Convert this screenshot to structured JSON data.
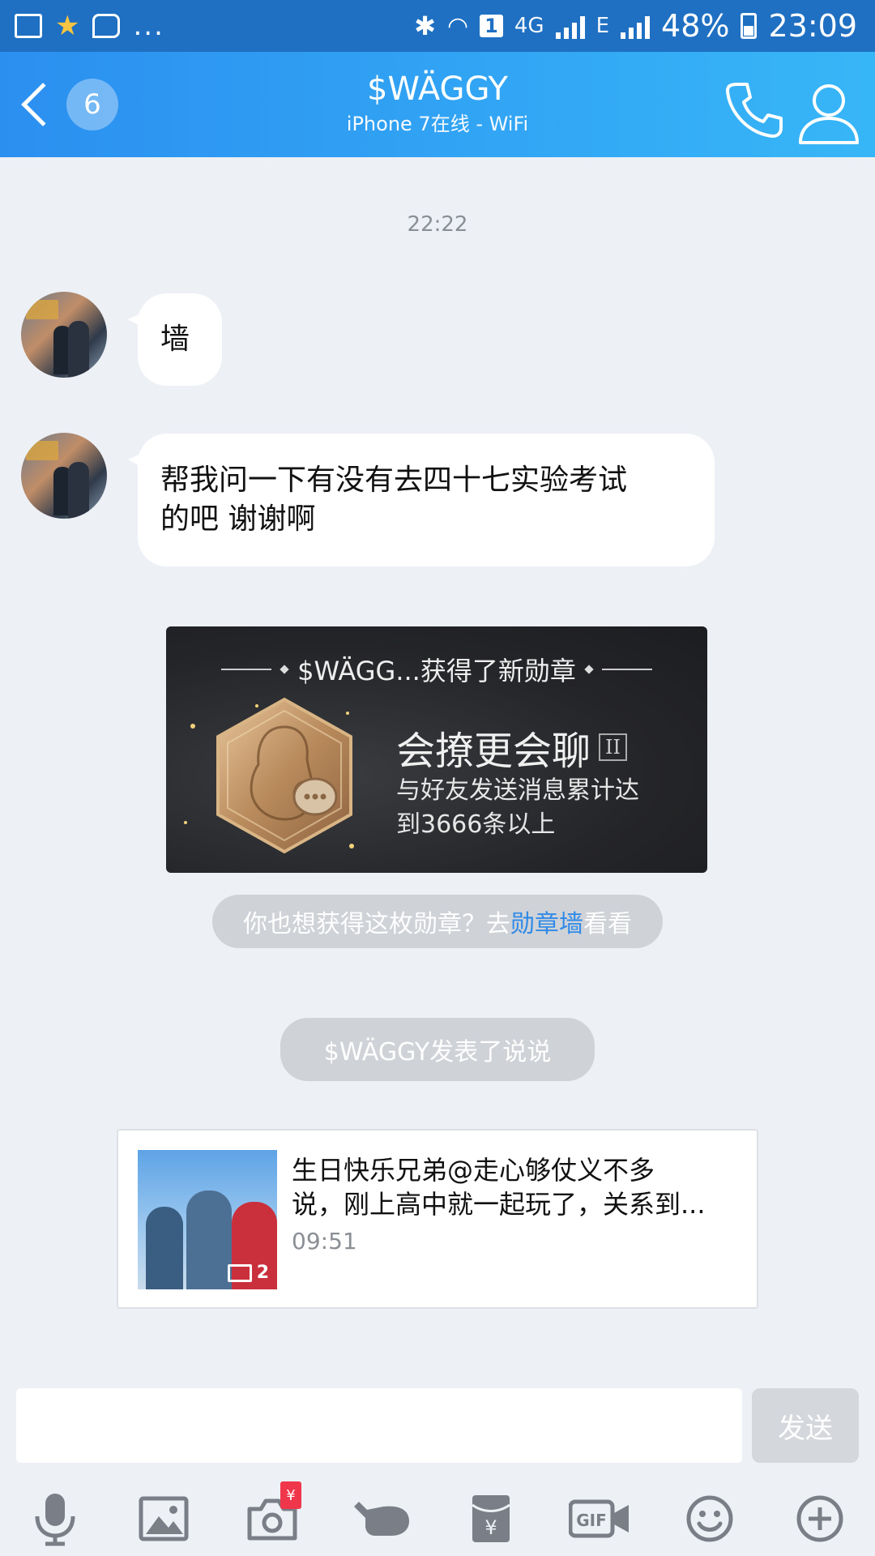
{
  "status_bar": {
    "time": "23:09",
    "battery": "48%",
    "network_4g": "4G",
    "network_e": "E",
    "sim_slot": "1",
    "more": "..."
  },
  "header": {
    "back_badge": "6",
    "contact_name": "$WÄGGY",
    "contact_status": "iPhone 7在线 - WiFi",
    "call_icon": "phone-icon",
    "profile_icon": "person-icon"
  },
  "chat": {
    "timestamp": "22:22",
    "messages": [
      {
        "text": "墙"
      },
      {
        "text_line1": "帮我问一下有没有去四十七实验考试",
        "text_line2": "的吧 谢谢啊"
      }
    ],
    "badge_card": {
      "header": "$WÄGG...获得了新勋章",
      "title": "会撩更会聊",
      "level": "II",
      "desc_line1": "与好友发送消息累计达",
      "desc_line2": "到3666条以上"
    },
    "badge_prompt": {
      "prefix": "你也想获得这枚勋章？去",
      "link": "勋章墙",
      "suffix": "看看"
    },
    "post_notice": "$WÄGGY发表了说说",
    "post": {
      "line1": "生日快乐兄弟@走心够仗义不多",
      "line2": "说，刚上高中就一起玩了，关系到...",
      "time": "09:51",
      "image_count": "2"
    }
  },
  "input": {
    "placeholder": "",
    "send_label": "发送"
  },
  "toolbar": {
    "items": [
      "microphone-icon",
      "image-icon",
      "camera-icon",
      "poke-icon",
      "red-packet-icon",
      "gif-icon",
      "emoji-icon",
      "plus-icon"
    ],
    "camera_badge": "¥"
  },
  "colors": {
    "header_start": "#2b8ff0",
    "header_end": "#37b6f7",
    "background": "#edf1f6",
    "link": "#2f8ae8"
  }
}
